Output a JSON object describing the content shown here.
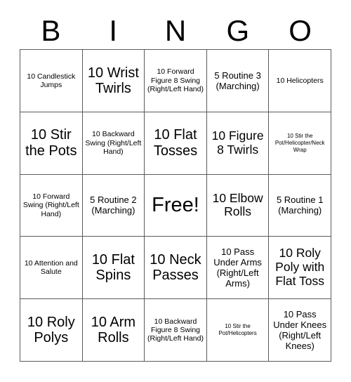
{
  "card": {
    "title_letters": [
      "B",
      "I",
      "N",
      "G",
      "O"
    ],
    "columns": 5,
    "rows": 5,
    "free_space_label": "Free!",
    "border_color": "#5a5a5a",
    "background_color": "#ffffff",
    "text_color": "#000000",
    "cells": [
      {
        "text": "10 Candlestick Jumps",
        "size": "sm"
      },
      {
        "text": "10 Wrist Twirls",
        "size": "xl"
      },
      {
        "text": "10 Forward Figure 8 Swing (Right/Left Hand)",
        "size": "sm"
      },
      {
        "text": "5 Routine 3 (Marching)",
        "size": "md"
      },
      {
        "text": "10 Helicopters",
        "size": "sm"
      },
      {
        "text": "10 Stir the Pots",
        "size": "xl"
      },
      {
        "text": "10 Backward Swing (Right/Left Hand)",
        "size": "sm"
      },
      {
        "text": "10 Flat Tosses",
        "size": "xl"
      },
      {
        "text": "10 Figure 8 Twirls",
        "size": "lg"
      },
      {
        "text": "10 Stir the Pot/Helicopter/Neck Wrap",
        "size": "xs"
      },
      {
        "text": "10 Forward Swing (Right/Left Hand)",
        "size": "sm"
      },
      {
        "text": "5 Routine 2 (Marching)",
        "size": "md"
      },
      {
        "text": "Free!",
        "size": "free"
      },
      {
        "text": "10 Elbow Rolls",
        "size": "lg"
      },
      {
        "text": "5 Routine 1 (Marching)",
        "size": "md"
      },
      {
        "text": "10 Attention and Salute",
        "size": "sm"
      },
      {
        "text": "10 Flat Spins",
        "size": "xl"
      },
      {
        "text": "10 Neck Passes",
        "size": "xl"
      },
      {
        "text": "10 Pass Under Arms (Right/Left Arms)",
        "size": "md"
      },
      {
        "text": "10 Roly Poly with Flat Toss",
        "size": "lg"
      },
      {
        "text": "10 Roly Polys",
        "size": "xl"
      },
      {
        "text": "10 Arm Rolls",
        "size": "xl"
      },
      {
        "text": "10 Backward Figure 8 Swing (Right/Left Hand)",
        "size": "sm"
      },
      {
        "text": "10 Stir the Pot/Helicopters",
        "size": "xs"
      },
      {
        "text": "10 Pass Under Knees (Right/Left Knees)",
        "size": "md"
      }
    ]
  }
}
